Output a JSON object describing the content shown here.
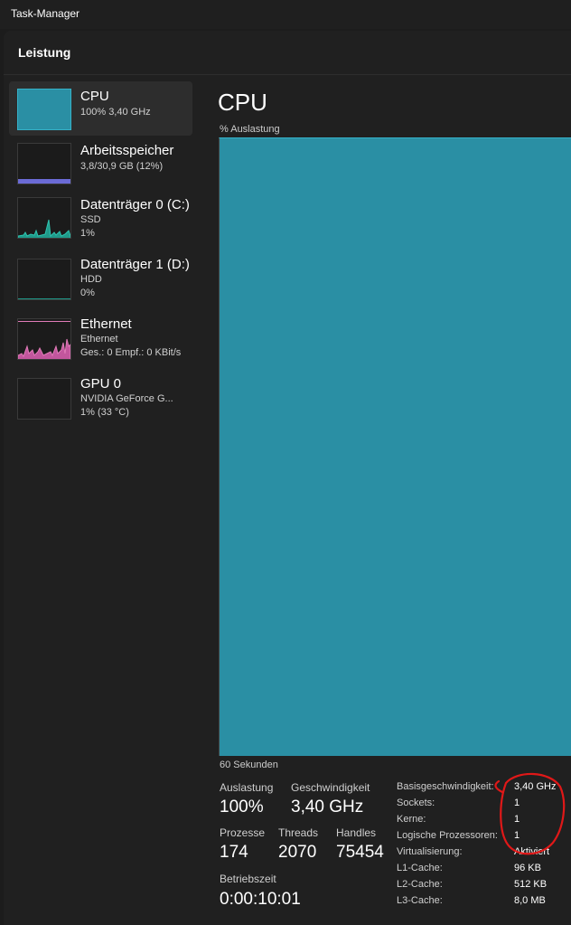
{
  "window": {
    "title": "Task-Manager"
  },
  "header": {
    "title": "Leistung"
  },
  "sidebar": {
    "items": [
      {
        "title": "CPU",
        "sub1": "100%  3,40 GHz",
        "sub2": ""
      },
      {
        "title": "Arbeitsspeicher",
        "sub1": "3,8/30,9 GB (12%)",
        "sub2": ""
      },
      {
        "title": "Datenträger 0 (C:)",
        "sub1": "SSD",
        "sub2": "1%"
      },
      {
        "title": "Datenträger 1 (D:)",
        "sub1": "HDD",
        "sub2": "0%"
      },
      {
        "title": "Ethernet",
        "sub1": "Ethernet",
        "sub2": "Ges.: 0  Empf.: 0 KBit/s"
      },
      {
        "title": "GPU 0",
        "sub1": "NVIDIA GeForce G...",
        "sub2": "1%  (33 °C)"
      }
    ]
  },
  "main": {
    "title": "CPU",
    "graph_label": "% Auslastung",
    "time_label": "60 Sekunden",
    "stats": {
      "auslastung_label": "Auslastung",
      "auslastung_value": "100%",
      "geschwindigkeit_label": "Geschwindigkeit",
      "geschwindigkeit_value": "3,40 GHz",
      "prozesse_label": "Prozesse",
      "prozesse_value": "174",
      "threads_label": "Threads",
      "threads_value": "2070",
      "handles_label": "Handles",
      "handles_value": "75454",
      "betriebszeit_label": "Betriebszeit",
      "betriebszeit_value": "0:00:10:01"
    },
    "specs": [
      {
        "label": "Basisgeschwindigkeit:",
        "value": "3,40 GHz"
      },
      {
        "label": "Sockets:",
        "value": "1"
      },
      {
        "label": "Kerne:",
        "value": "1"
      },
      {
        "label": "Logische Prozessoren:",
        "value": "1"
      },
      {
        "label": "Virtualisierung:",
        "value": "Aktiviert"
      },
      {
        "label": "L1-Cache:",
        "value": "96 KB"
      },
      {
        "label": "L2-Cache:",
        "value": "512 KB"
      },
      {
        "label": "L3-Cache:",
        "value": "8,0 MB"
      }
    ],
    "cpu_utilization_percent": 100
  },
  "colors": {
    "cpu_accent": "#2a8fa4",
    "memory_accent": "#6b6bd6",
    "disk_accent": "#1f9a8a",
    "ethernet_accent": "#e07bb8",
    "annotation": "#e01818"
  }
}
